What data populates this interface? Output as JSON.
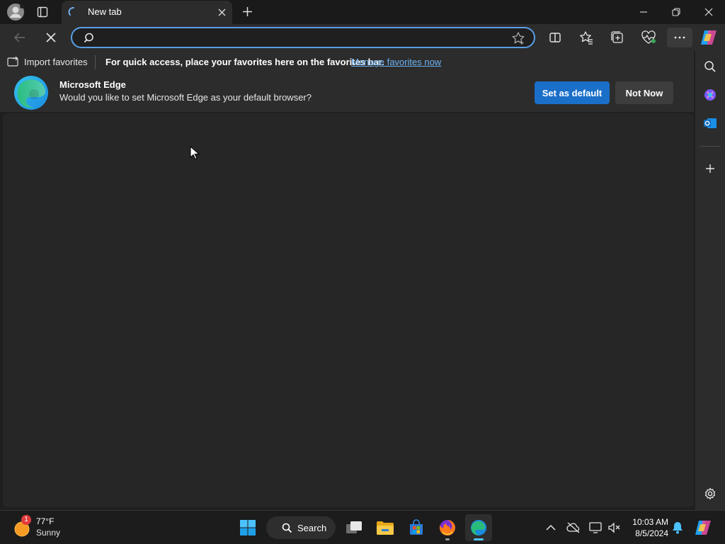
{
  "tab": {
    "title": "New tab"
  },
  "address": {
    "value": "",
    "placeholder": ""
  },
  "favorites_bar": {
    "import_label": "Import favorites",
    "message": "For quick access, place your favorites here on the favorites bar.",
    "link": "Manage favorites now"
  },
  "banner": {
    "title": "Microsoft Edge",
    "text": "Would you like to set Microsoft Edge as your default browser?",
    "primary": "Set as default",
    "secondary": "Not Now"
  },
  "taskbar": {
    "weather": {
      "temp": "77°F",
      "condition": "Sunny",
      "badge": "1"
    },
    "search_label": "Search",
    "time": "10:03 AM",
    "date": "8/5/2024"
  },
  "colors": {
    "accent": "#1a6fc8",
    "link": "#6fb3f2",
    "address_border": "#5a9fe6",
    "page_bg": "#262626"
  },
  "icons": [
    "profile-icon",
    "tab-actions-icon",
    "loading-spinner-icon",
    "close-icon",
    "plus-icon",
    "minimize-icon",
    "restore-icon",
    "window-close-icon",
    "back-arrow-icon",
    "stop-icon",
    "search-icon",
    "star-icon",
    "split-screen-icon",
    "favorites-icon",
    "collections-icon",
    "browser-essentials-icon",
    "more-icon",
    "copilot-icon",
    "import-icon",
    "edge-logo-icon",
    "outlook-icon",
    "settings-icon",
    "windows-start-icon",
    "task-view-icon",
    "file-explorer-icon",
    "store-icon",
    "firefox-icon",
    "edge-icon",
    "chevron-up-icon",
    "onedrive-icon",
    "network-icon",
    "volume-icon",
    "bell-icon",
    "sun-icon"
  ]
}
